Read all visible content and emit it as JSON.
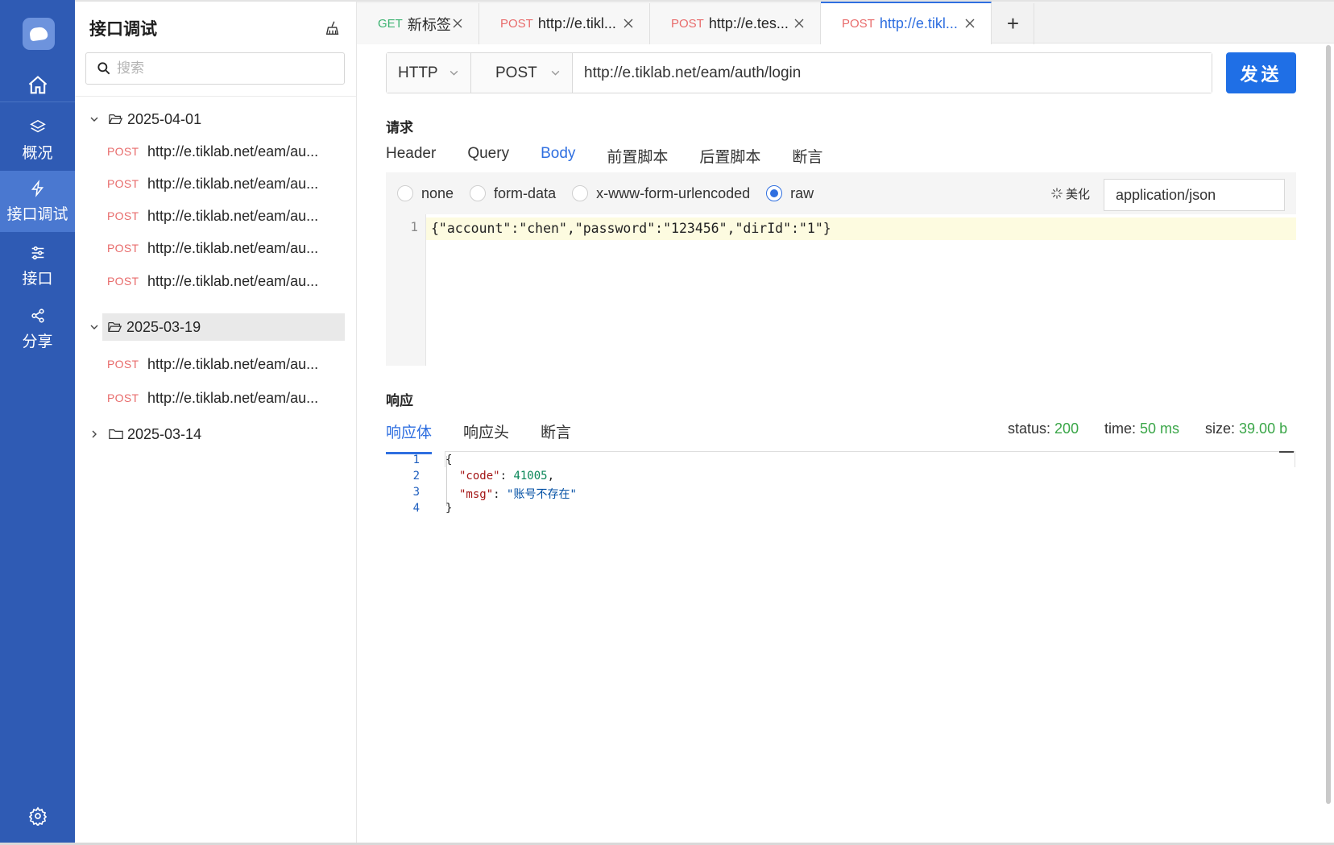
{
  "nav": {
    "items": [
      {
        "label": "概况",
        "icon": "layers-icon"
      },
      {
        "label": "接口调试",
        "icon": "lightning-icon"
      },
      {
        "label": "接口",
        "icon": "sliders-icon"
      },
      {
        "label": "分享",
        "icon": "share-icon"
      }
    ],
    "active": "接口调试"
  },
  "sidebar": {
    "title": "接口调试",
    "search_placeholder": "搜索",
    "folders": [
      {
        "date": "2025-04-01",
        "expanded": true,
        "requests": [
          {
            "method": "POST",
            "url": "http://e.tiklab.net/eam/au..."
          },
          {
            "method": "POST",
            "url": "http://e.tiklab.net/eam/au..."
          },
          {
            "method": "POST",
            "url": "http://e.tiklab.net/eam/au..."
          },
          {
            "method": "POST",
            "url": "http://e.tiklab.net/eam/au..."
          },
          {
            "method": "POST",
            "url": "http://e.tiklab.net/eam/au..."
          }
        ]
      },
      {
        "date": "2025-03-19",
        "expanded": true,
        "selected": true,
        "requests": [
          {
            "method": "POST",
            "url": "http://e.tiklab.net/eam/au..."
          },
          {
            "method": "POST",
            "url": "http://e.tiklab.net/eam/au..."
          }
        ]
      },
      {
        "date": "2025-03-14",
        "expanded": false,
        "requests": []
      }
    ]
  },
  "tabs": [
    {
      "method": "GET",
      "title": "新标签"
    },
    {
      "method": "POST",
      "title": "http://e.tikl..."
    },
    {
      "method": "POST",
      "title": "http://e.tes..."
    },
    {
      "method": "POST",
      "title": "http://e.tikl...",
      "active": true
    }
  ],
  "tab_add": "+",
  "request": {
    "protocol": "HTTP",
    "method": "POST",
    "url": "http://e.tiklab.net/eam/auth/login",
    "send_label": "发送",
    "section_title": "请求",
    "subtabs": [
      "Header",
      "Query",
      "Body",
      "前置脚本",
      "后置脚本",
      "断言"
    ],
    "active_subtab": "Body",
    "body_types": [
      "none",
      "form-data",
      "x-www-form-urlencoded",
      "raw"
    ],
    "active_body_type": "raw",
    "beautify_label": "美化",
    "content_type": "application/json",
    "body_line_number": "1",
    "body_code": "{\"account\":\"chen\",\"password\":\"123456\",\"dirId\":\"1\"}"
  },
  "response": {
    "section_title": "响应",
    "subtabs": [
      "响应体",
      "响应头",
      "断言"
    ],
    "active_subtab": "响应体",
    "status_label": "status:",
    "status_value": "200",
    "time_label": "time:",
    "time_value": "50 ms",
    "size_label": "size:",
    "size_value": "39.00 b",
    "code_key": "\"code\"",
    "code_value": "41005",
    "msg_key": "\"msg\"",
    "msg_value": "\"账号不存在\""
  },
  "colors": {
    "nav_bg": "#2f5bb4",
    "accent": "#2f6fe0",
    "post_method": "#e86b6b",
    "get_method": "#3cb371",
    "status_green": "#3aa648"
  }
}
